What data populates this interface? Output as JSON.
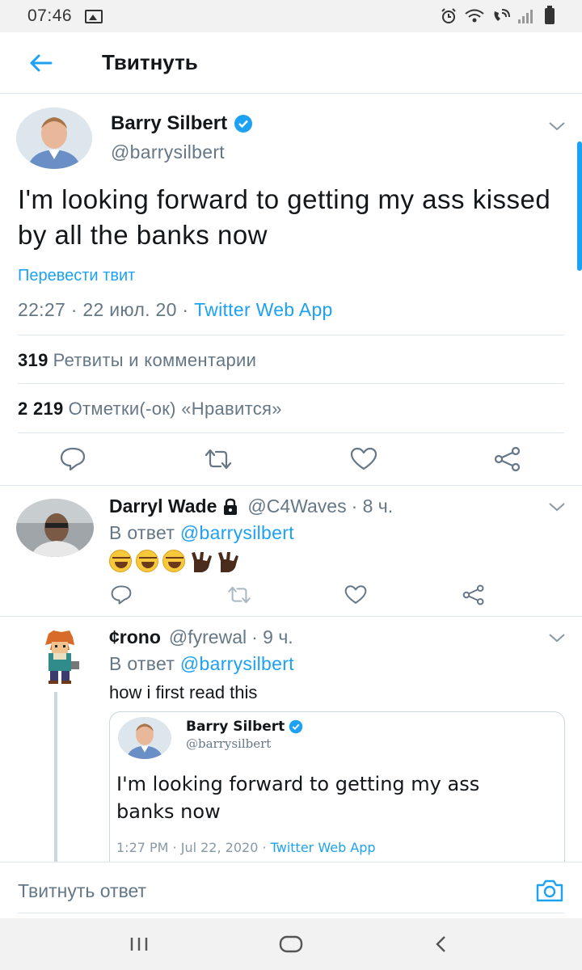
{
  "status": {
    "time": "07:46",
    "icons": [
      "gallery-icon",
      "alarm-icon",
      "wifi-icon",
      "volte-icon",
      "signal-icon",
      "battery-icon"
    ]
  },
  "header": {
    "title": "Твитнуть",
    "back_icon": "arrow-left-icon"
  },
  "colors": {
    "accent": "#1da1f2",
    "text": "#14171a",
    "secondary": "#657786"
  },
  "tweet": {
    "name": "Barry Silbert",
    "handle": "@barrysilbert",
    "text": "I'm looking forward to getting my ass kissed by all the banks now",
    "translate": "Перевести твит",
    "time_date": "22:27 · 22 июл. 20 · ",
    "source": "Twitter Web App",
    "retweets_count": "319",
    "retweets_label": "Ретвиты и комментарии",
    "likes_count": "2 219",
    "likes_label": "Отметки(-ок) «Нравится»"
  },
  "replies": [
    {
      "name": "Darryl Wade",
      "handle": "@C4Waves",
      "time": " · 8 ч.",
      "reply_prefix": "В ответ ",
      "reply_to": "@barrysilbert",
      "emojis": [
        "rolling-laughing",
        "rolling-laughing",
        "rolling-laughing",
        "horns-dark",
        "horns-dark"
      ]
    },
    {
      "name": "¢rono",
      "handle": "@fyrewal",
      "time": " · 9 ч.",
      "reply_prefix": "В ответ ",
      "reply_to": "@barrysilbert",
      "text": "how i first read this",
      "quote": {
        "name": "Barry Silbert",
        "handle": "@barrysilbert",
        "line1": "I'm looking forward to getting my ass",
        "line2": "banks now",
        "meta": "1:27 PM · Jul 22, 2020 · ",
        "source": "Twitter Web App"
      }
    }
  ],
  "composer": {
    "placeholder": "Твитнуть ответ"
  }
}
